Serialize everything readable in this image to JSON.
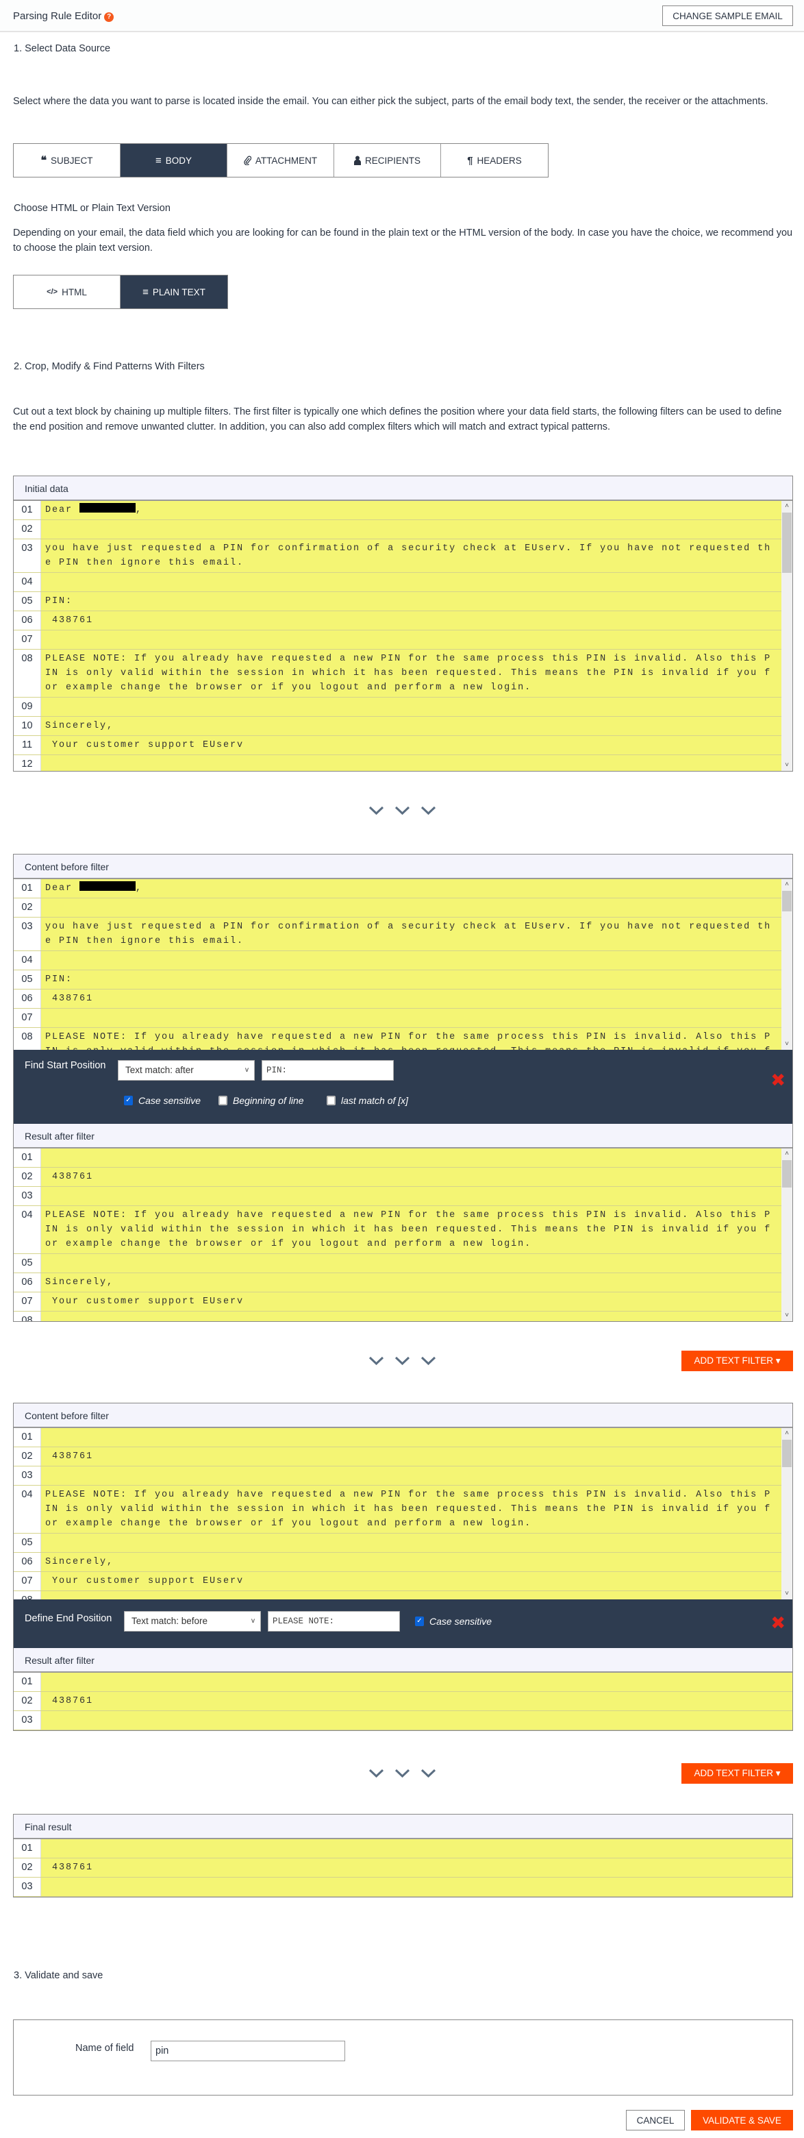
{
  "header": {
    "title": "Parsing Rule Editor",
    "help_icon": "question-circle-icon",
    "change_sample_label": "CHANGE SAMPLE EMAIL"
  },
  "step1": {
    "title": "1.  Select Data Source",
    "description": "Select where the data you want to parse is located inside the email. You can either pick the subject, parts of the email body text, the sender, the receiver or the attachments.",
    "source_tabs": [
      {
        "label": "SUBJECT",
        "icon": "quote-icon",
        "active": false
      },
      {
        "label": "BODY",
        "icon": "align-left-icon",
        "active": true
      },
      {
        "label": "ATTACHMENT",
        "icon": "paperclip-icon",
        "active": false
      },
      {
        "label": "RECIPIENTS",
        "icon": "user-icon",
        "active": false
      },
      {
        "label": "HEADERS",
        "icon": "paragraph-icon",
        "active": false
      }
    ],
    "version_title": "Choose HTML or Plain Text Version",
    "version_description": "Depending on your email, the data field which you are looking for can be found in the plain text or the HTML version of the body. In case you have the choice, we recommend you to choose the plain text version.",
    "version_tabs": [
      {
        "label": "HTML",
        "icon": "code-icon",
        "active": false
      },
      {
        "label": "PLAIN TEXT",
        "icon": "align-left-icon",
        "active": true
      }
    ]
  },
  "step2": {
    "title": "2.  Crop, Modify & Find Patterns With Filters",
    "description": "Cut out a text block by chaining up multiple filters. The first filter is typically one which defines the position where your data field starts, the following filters can be used to define the end position and remove unwanted clutter. In addition, you can also add complex filters which will match and extract typical patterns.",
    "initial": {
      "title": "Initial data",
      "lines": [
        {
          "num": "01",
          "text": "Dear ",
          "redacted": true,
          "suffix": ","
        },
        {
          "num": "02",
          "text": ""
        },
        {
          "num": "03",
          "text": "you have just requested a PIN for confirmation of a security check at EUserv. If you have not requested the PIN then ignore this email."
        },
        {
          "num": "04",
          "text": ""
        },
        {
          "num": "05",
          "text": "PIN:"
        },
        {
          "num": "06",
          "text": " 438761"
        },
        {
          "num": "07",
          "text": ""
        },
        {
          "num": "08",
          "text": "PLEASE NOTE: If you already have requested a new PIN for the same process this PIN is invalid. Also this PIN is only valid within the session in which it has been requested. This means the PIN is invalid if you for example change the browser or if you logout and perform a new login."
        },
        {
          "num": "09",
          "text": ""
        },
        {
          "num": "10",
          "text": "Sincerely,"
        },
        {
          "num": "11",
          "text": " Your customer support EUserv"
        },
        {
          "num": "12",
          "text": ""
        }
      ]
    },
    "filter1": {
      "before_title": "Content before filter",
      "before_lines": [
        {
          "num": "01",
          "text": "Dear ",
          "redacted": true,
          "suffix": ","
        },
        {
          "num": "02",
          "text": ""
        },
        {
          "num": "03",
          "text": "you have just requested a PIN for confirmation of a security check at EUserv. If you have not requested the PIN then ignore this email."
        },
        {
          "num": "04",
          "text": ""
        },
        {
          "num": "05",
          "text": "PIN:"
        },
        {
          "num": "06",
          "text": " 438761"
        },
        {
          "num": "07",
          "text": ""
        },
        {
          "num": "08",
          "text": "PLEASE NOTE: If you already have requested a new PIN for the same process this PIN is invalid. Also this PIN is only valid within the session in which it has been requested. This means the PIN is invalid if you for example change the browser or if you logout and perform a new login."
        }
      ],
      "label": "Find Start Position",
      "mode": "Text match: after",
      "value": "PIN:",
      "options": [
        {
          "label": "Case sensitive",
          "checked": true
        },
        {
          "label": "Beginning of line",
          "checked": false
        },
        {
          "label": "last match of [x]",
          "checked": false
        }
      ],
      "result_title": "Result after filter",
      "result_lines": [
        {
          "num": "01",
          "text": ""
        },
        {
          "num": "02",
          "text": " 438761"
        },
        {
          "num": "03",
          "text": ""
        },
        {
          "num": "04",
          "text": "PLEASE NOTE: If you already have requested a new PIN for the same process this PIN is invalid. Also this PIN is only valid within the session in which it has been requested. This means the PIN is invalid if you for example change the browser or if you logout and perform a new login."
        },
        {
          "num": "05",
          "text": ""
        },
        {
          "num": "06",
          "text": "Sincerely,"
        },
        {
          "num": "07",
          "text": " Your customer support EUserv"
        },
        {
          "num": "08",
          "text": ""
        }
      ]
    },
    "filter2": {
      "before_title": "Content before filter",
      "before_lines": [
        {
          "num": "01",
          "text": ""
        },
        {
          "num": "02",
          "text": " 438761"
        },
        {
          "num": "03",
          "text": ""
        },
        {
          "num": "04",
          "text": "PLEASE NOTE: If you already have requested a new PIN for the same process this PIN is invalid. Also this PIN is only valid within the session in which it has been requested. This means the PIN is invalid if you for example change the browser or if you logout and perform a new login."
        },
        {
          "num": "05",
          "text": ""
        },
        {
          "num": "06",
          "text": "Sincerely,"
        },
        {
          "num": "07",
          "text": " Your customer support EUserv"
        },
        {
          "num": "08",
          "text": ""
        }
      ],
      "label": "Define End Position",
      "mode": "Text match: before",
      "value": "PLEASE NOTE:",
      "options": [
        {
          "label": "Case sensitive",
          "checked": true
        }
      ],
      "result_title": "Result after filter",
      "result_lines": [
        {
          "num": "01",
          "text": ""
        },
        {
          "num": "02",
          "text": " 438761"
        },
        {
          "num": "03",
          "text": ""
        }
      ]
    },
    "add_filter_label": "ADD TEXT FILTER ▾",
    "final": {
      "title": "Final result",
      "lines": [
        {
          "num": "01",
          "text": ""
        },
        {
          "num": "02",
          "text": " 438761"
        },
        {
          "num": "03",
          "text": ""
        }
      ]
    }
  },
  "step3": {
    "title": "3.  Validate and save",
    "field_label": "Name of field",
    "field_value": "pin",
    "cancel_label": "CANCEL",
    "save_label": "VALIDATE & SAVE"
  },
  "colors": {
    "accent": "#fe4a00",
    "dark": "#2e3c50",
    "highlight": "#f4f574"
  }
}
